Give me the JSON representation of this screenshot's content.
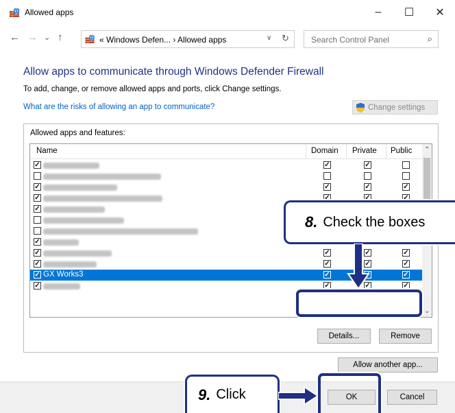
{
  "window": {
    "title": "Allowed apps",
    "minimize": "–",
    "maximize": "☐",
    "close": "✕"
  },
  "nav": {
    "back": "←",
    "forward": "→",
    "recent": "⌄",
    "up": "↑",
    "breadcrumb": "«  Windows Defen...  ›  Allowed apps",
    "dropdown": "∨",
    "refresh": "↻",
    "search_placeholder": "Search Control Panel",
    "search_icon": "⌕"
  },
  "content": {
    "heading": "Allow apps to communicate through Windows Defender Firewall",
    "instruction": "To add, change, or remove allowed apps and ports, click Change settings.",
    "risk_link": "What are the risks of allowing an app to communicate?",
    "change_settings": "Change settings",
    "group_label": "Allowed apps and features:",
    "columns": {
      "name": "Name",
      "domain": "Domain",
      "private": "Private",
      "public": "Public"
    },
    "rows": [
      {
        "name": "",
        "enabled": true,
        "domain": true,
        "private": true,
        "public": false
      },
      {
        "name": "",
        "enabled": false,
        "domain": false,
        "private": false,
        "public": false
      },
      {
        "name": "",
        "enabled": true,
        "domain": true,
        "private": true,
        "public": true
      },
      {
        "name": "",
        "enabled": true,
        "domain": true,
        "private": true,
        "public": true
      },
      {
        "name": "",
        "enabled": true,
        "domain": true,
        "private": true,
        "public": true
      },
      {
        "name": "",
        "enabled": false,
        "domain": false,
        "private": false,
        "public": false
      },
      {
        "name": "",
        "enabled": false,
        "domain": false,
        "private": false,
        "public": false
      },
      {
        "name": "",
        "enabled": true,
        "domain": true,
        "private": true,
        "public": true
      },
      {
        "name": "",
        "enabled": true,
        "domain": true,
        "private": true,
        "public": true
      },
      {
        "name": "",
        "enabled": true,
        "domain": true,
        "private": true,
        "public": true
      },
      {
        "name": "GX Works3",
        "enabled": true,
        "domain": true,
        "private": true,
        "public": true,
        "selected": true
      },
      {
        "name": "",
        "enabled": true,
        "domain": true,
        "private": true,
        "public": true
      }
    ],
    "details": "Details...",
    "remove": "Remove",
    "allow_another": "Allow another app..."
  },
  "footer": {
    "ok": "OK",
    "cancel": "Cancel"
  },
  "annotations": {
    "step8_number": "8.",
    "step8_text": "Check the boxes",
    "step9_number": "9.",
    "step9_text": "Click"
  },
  "colors": {
    "accent": "#1f2f83",
    "selection": "#0077d7",
    "heading": "#1e3287",
    "link": "#0062c4"
  }
}
